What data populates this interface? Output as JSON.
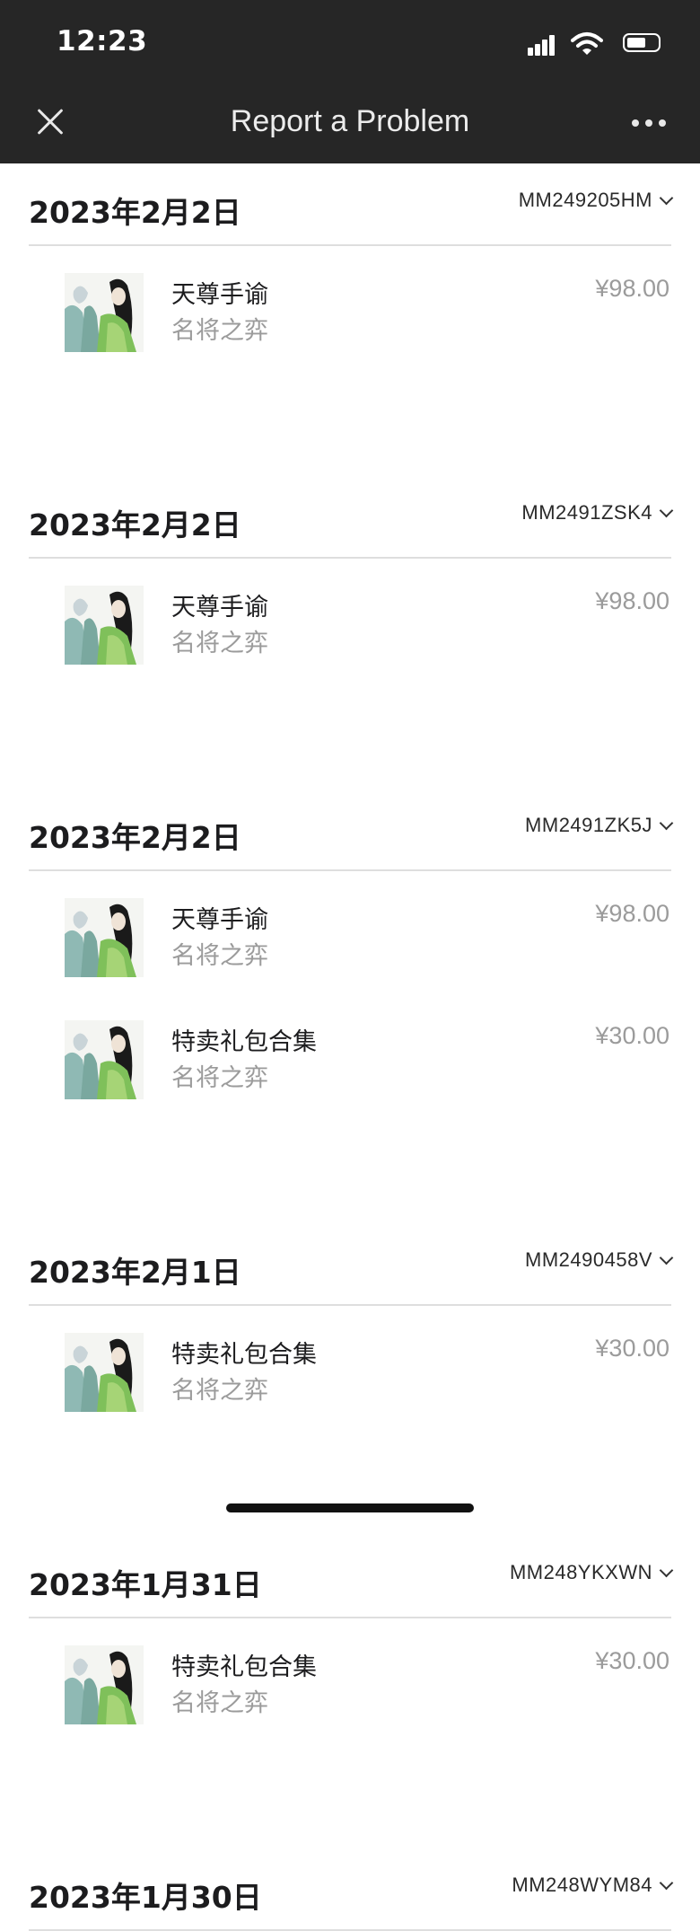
{
  "status_bar": {
    "time": "12:23"
  },
  "header": {
    "title": "Report a Problem"
  },
  "orders": [
    {
      "date": "2023年2月2日",
      "order_id": "MM249205HM",
      "items": [
        {
          "name": "天尊手谕",
          "developer": "名将之弈",
          "price": "¥98.00"
        }
      ]
    },
    {
      "date": "2023年2月2日",
      "order_id": "MM2491ZSK4",
      "items": [
        {
          "name": "天尊手谕",
          "developer": "名将之弈",
          "price": "¥98.00"
        }
      ]
    },
    {
      "date": "2023年2月2日",
      "order_id": "MM2491ZK5J",
      "items": [
        {
          "name": "天尊手谕",
          "developer": "名将之弈",
          "price": "¥98.00"
        },
        {
          "name": "特卖礼包合集",
          "developer": "名将之弈",
          "price": "¥30.00"
        }
      ]
    },
    {
      "date": "2023年2月1日",
      "order_id": "MM2490458V",
      "items": [
        {
          "name": "特卖礼包合集",
          "developer": "名将之弈",
          "price": "¥30.00"
        }
      ]
    },
    {
      "date": "2023年1月31日",
      "order_id": "MM248YKXWN",
      "items": [
        {
          "name": "特卖礼包合集",
          "developer": "名将之弈",
          "price": "¥30.00"
        }
      ]
    },
    {
      "date": "2023年1月30日",
      "order_id": "MM248WYM84",
      "items": []
    }
  ],
  "icons": {
    "close": "close-icon",
    "more": "more-icon",
    "chevron": "chevron-down-icon",
    "signal": "signal-icon",
    "wifi": "wifi-icon",
    "battery": "battery-icon"
  }
}
